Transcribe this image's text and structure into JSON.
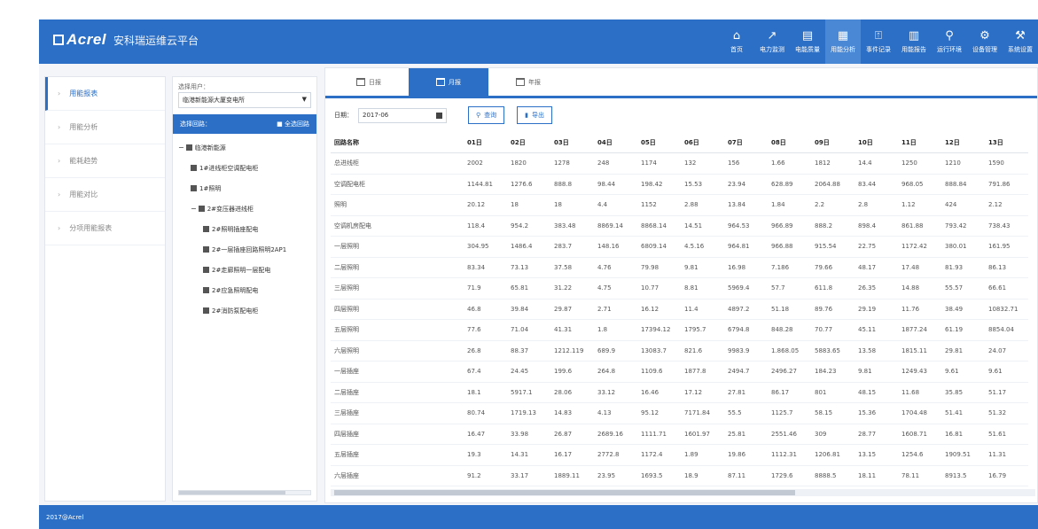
{
  "header": {
    "logo": "Acrel",
    "title": "安科瑞运维云平台",
    "nav": [
      {
        "label": "首页",
        "icon": "⌂"
      },
      {
        "label": "电力监测",
        "icon": "↗"
      },
      {
        "label": "电能质量",
        "icon": "▤"
      },
      {
        "label": "用能分析",
        "icon": "▦"
      },
      {
        "label": "事件记录",
        "icon": "⍐"
      },
      {
        "label": "用能报告",
        "icon": "▥"
      },
      {
        "label": "运行环境",
        "icon": "⚲"
      },
      {
        "label": "设备管理",
        "icon": "⚙"
      },
      {
        "label": "系统设置",
        "icon": "⚒"
      }
    ]
  },
  "sidebar": {
    "items": [
      {
        "label": "用能报表"
      },
      {
        "label": "用能分析"
      },
      {
        "label": "能耗趋势"
      },
      {
        "label": "用能对比"
      },
      {
        "label": "分项用能报表"
      }
    ]
  },
  "tree_panel": {
    "select_label": "选择用户：",
    "select_value": "临港新能源大厦变电所",
    "header_label": "选择回路：",
    "header_action": "■ 全选回路",
    "nodes": [
      {
        "label": "临港新能源",
        "toggle": "−",
        "level": 0
      },
      {
        "label": "1#进线柜空调配电柜",
        "toggle": "",
        "level": 1
      },
      {
        "label": "1#照明",
        "toggle": "",
        "level": 1
      },
      {
        "label": "2#变压器进线柜",
        "toggle": "−",
        "level": 1
      },
      {
        "label": "2#照明插座配电",
        "toggle": "",
        "level": 2
      },
      {
        "label": "2#一层插座回路照明2AP1",
        "toggle": "",
        "level": 2
      },
      {
        "label": "2#走廊照明一层配电",
        "toggle": "",
        "level": 2
      },
      {
        "label": "2#应急照明配电",
        "toggle": "",
        "level": 2
      },
      {
        "label": "2#消防泵配电柜",
        "toggle": "",
        "level": 2
      }
    ]
  },
  "content": {
    "tabs": [
      {
        "label": "日报"
      },
      {
        "label": "月报"
      },
      {
        "label": "年报"
      }
    ],
    "date_label": "日期：",
    "date_value": "2017-06",
    "query_button": "查询",
    "export_button": "导出",
    "table": {
      "headers": [
        "回路名称",
        "01日",
        "02日",
        "03日",
        "04日",
        "05日",
        "06日",
        "07日",
        "08日",
        "09日",
        "10日",
        "11日",
        "12日",
        "13日"
      ],
      "rows": [
        [
          "总进线柜",
          "2002",
          "1820",
          "1278",
          "248",
          "1174",
          "132",
          "156",
          "1.66",
          "1812",
          "14.4",
          "1250",
          "1210",
          "1590"
        ],
        [
          "空调配电柜",
          "1144.81",
          "1276.6",
          "888.8",
          "98.44",
          "198.42",
          "15.53",
          "23.94",
          "628.89",
          "2064.88",
          "83.44",
          "968.05",
          "888.84",
          "791.86"
        ],
        [
          "照明",
          "20.12",
          "18",
          "18",
          "4.4",
          "1152",
          "2.88",
          "13.84",
          "1.84",
          "2.2",
          "2.8",
          "1.12",
          "424",
          "2.12"
        ],
        [
          "空调机房配电",
          "118.4",
          "954.2",
          "383.48",
          "8869.14",
          "8868.14",
          "14.51",
          "964.53",
          "966.89",
          "888.2",
          "898.4",
          "861.88",
          "793.42",
          "738.43"
        ],
        [
          "一层照明",
          "304.95",
          "1486.4",
          "283.7",
          "148.16",
          "6809.14",
          "4.5.16",
          "964.81",
          "966.88",
          "915.54",
          "22.75",
          "1172.42",
          "380.01",
          "161.95"
        ],
        [
          "二层照明",
          "83.34",
          "73.13",
          "37.58",
          "4.76",
          "79.98",
          "9.81",
          "16.98",
          "7.186",
          "79.66",
          "48.17",
          "17.48",
          "81.93",
          "86.13"
        ],
        [
          "三层照明",
          "71.9",
          "65.81",
          "31.22",
          "4.75",
          "10.77",
          "8.81",
          "5969.4",
          "57.7",
          "611.8",
          "26.35",
          "14.88",
          "55.57",
          "66.61"
        ],
        [
          "四层照明",
          "46.8",
          "39.84",
          "29.87",
          "2.71",
          "16.12",
          "11.4",
          "4897.2",
          "51.18",
          "89.76",
          "29.19",
          "11.76",
          "38.49",
          "10832.71"
        ],
        [
          "五层照明",
          "77.6",
          "71.04",
          "41.31",
          "1.8",
          "17394.12",
          "1795.7",
          "6794.8",
          "848.28",
          "70.77",
          "45.11",
          "1877.24",
          "61.19",
          "8854.04"
        ],
        [
          "六层照明",
          "26.8",
          "88.37",
          "1212.119",
          "689.9",
          "13083.7",
          "821.6",
          "9983.9",
          "1.868.05",
          "5883.65",
          "13.58",
          "1815.11",
          "29.81",
          "24.07"
        ],
        [
          "一层插座",
          "67.4",
          "24.45",
          "199.6",
          "264.8",
          "1109.6",
          "1877.8",
          "2494.7",
          "2496.27",
          "184.23",
          "9.81",
          "1249.43",
          "9.61",
          "9.61"
        ],
        [
          "二层插座",
          "18.1",
          "5917.1",
          "28.06",
          "33.12",
          "16.46",
          "17.12",
          "27.81",
          "86.17",
          "801",
          "48.15",
          "11.68",
          "35.85",
          "51.17"
        ],
        [
          "三层插座",
          "80.74",
          "1719.13",
          "14.83",
          "4.13",
          "95.12",
          "7171.84",
          "55.5",
          "1125.7",
          "58.15",
          "15.36",
          "1704.48",
          "51.41",
          "51.32"
        ],
        [
          "四层插座",
          "16.47",
          "33.98",
          "26.87",
          "2689.16",
          "1111.71",
          "1601.97",
          "25.81",
          "2551.46",
          "309",
          "28.77",
          "1608.71",
          "16.81",
          "51.61"
        ],
        [
          "五层插座",
          "19.3",
          "14.31",
          "16.17",
          "2772.8",
          "1172.4",
          "1.89",
          "19.86",
          "1112.31",
          "1206.81",
          "13.15",
          "1254.6",
          "1909.51",
          "11.31"
        ],
        [
          "六层插座",
          "91.2",
          "33.17",
          "1889.11",
          "23.95",
          "1693.5",
          "18.9",
          "87.11",
          "1729.6",
          "8888.5",
          "18.11",
          "78.11",
          "8913.5",
          "16.79"
        ]
      ]
    }
  },
  "footer": {
    "text": "2017@Acrel"
  },
  "colors": {
    "primary": "#2b6fc6",
    "nav_active": "#4a88d6",
    "background": "#f3f5f8"
  }
}
